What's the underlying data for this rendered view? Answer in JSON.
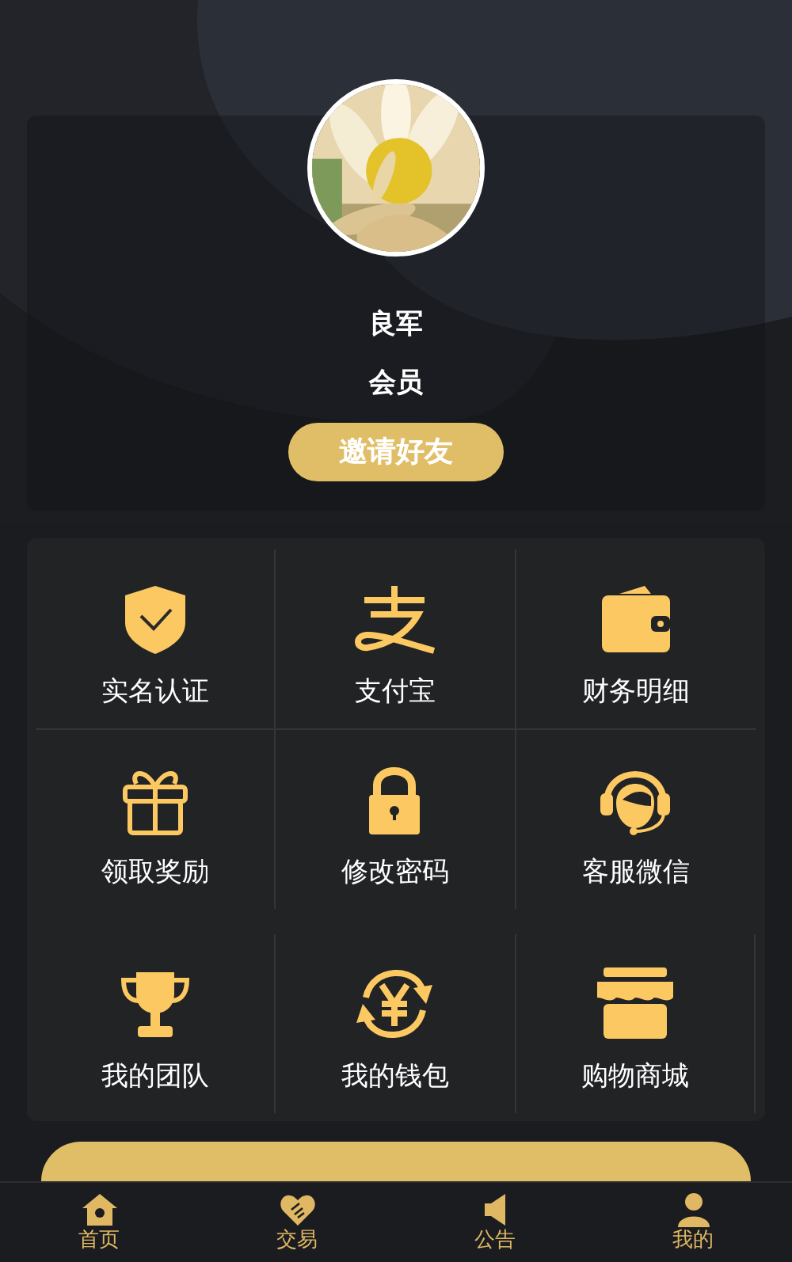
{
  "profile": {
    "name": "良军",
    "level": "会员",
    "invite_button": "邀请好友"
  },
  "menu": [
    {
      "label": "实名认证"
    },
    {
      "label": "支付宝"
    },
    {
      "label": "财务明细"
    },
    {
      "label": "领取奖励"
    },
    {
      "label": "修改密码"
    },
    {
      "label": "客服微信"
    },
    {
      "label": "我的团队"
    },
    {
      "label": "我的钱包"
    },
    {
      "label": "购物商城"
    }
  ],
  "tab_bar": [
    {
      "label": "首页"
    },
    {
      "label": "交易"
    },
    {
      "label": "公告"
    },
    {
      "label": "我的"
    }
  ]
}
